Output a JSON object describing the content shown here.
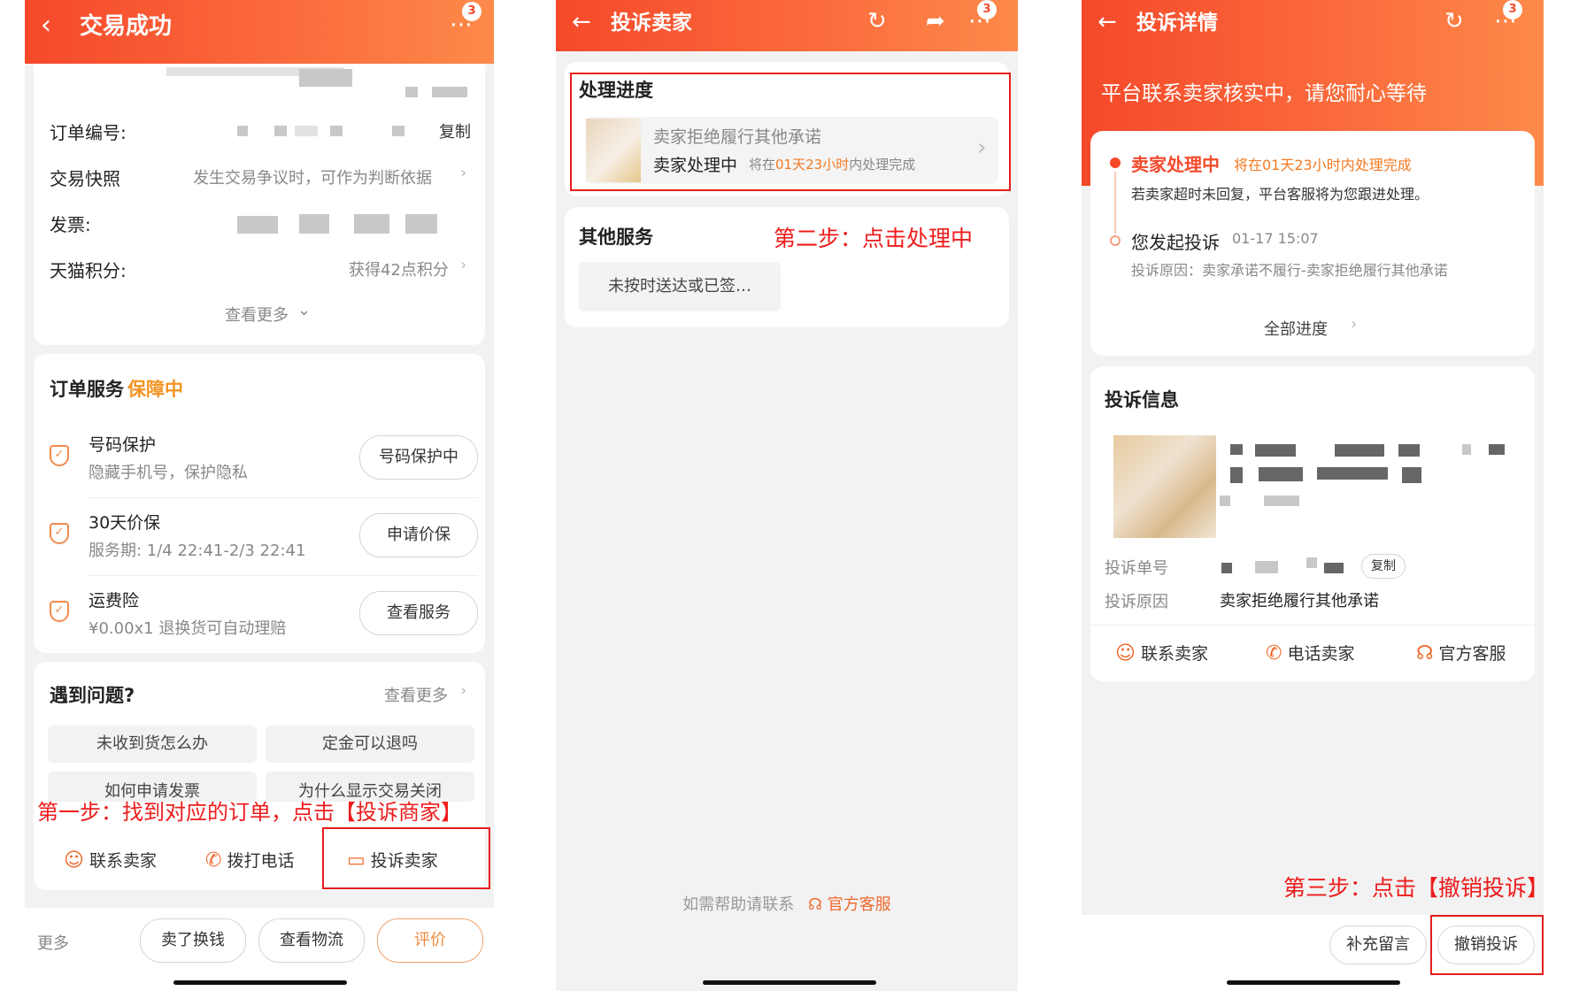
{
  "panel1": {
    "title": "交易成功",
    "badge": "3",
    "order_no_label": "订单编号:",
    "copy": "复制",
    "snapshot_label": "交易快照",
    "snapshot_value": "发生交易争议时，可作为判断依据",
    "invoice_label": "发票:",
    "points_label": "天猫积分:",
    "points_value": "获得42点积分",
    "see_more": "查看更多",
    "service_title": "订单服务",
    "service_status": "保障中",
    "services": [
      {
        "name": "号码保护",
        "desc": "隐藏手机号，保护隐私",
        "button": "号码保护中"
      },
      {
        "name": "30天价保",
        "desc": "服务期: 1/4 22:41-2/3 22:41",
        "button": "申请价保"
      },
      {
        "name": "运费险",
        "desc": "¥0.00x1 退换货可自动理赔",
        "button": "查看服务"
      }
    ],
    "problem_title": "遇到问题?",
    "problem_more": "查看更多",
    "faq": [
      "未收到货怎么办",
      "定金可以退吗",
      "如何申请发票",
      "为什么显示交易关闭"
    ],
    "step_note": "第一步：找到对应的订单，点击【投诉商家】",
    "actions": [
      "联系卖家",
      "拨打电话",
      "投诉卖家"
    ],
    "bottom_more": "更多",
    "bottom_buttons": [
      "卖了换钱",
      "查看物流",
      "评价"
    ]
  },
  "panel2": {
    "title": "投诉卖家",
    "badge": "3",
    "progress_title": "处理进度",
    "progress_reason": "卖家拒绝履行其他承诺",
    "progress_status": "卖家处理中",
    "progress_deadline_prefix": "将在",
    "progress_deadline_time": "01天23小时",
    "progress_deadline_suffix": "内处理完成",
    "other_title": "其他服务",
    "step_note": "第二步：点击处理中",
    "other_item": "未按时送达或已签…",
    "help_text": "如需帮助请联系",
    "help_link": "官方客服"
  },
  "panel3": {
    "title": "投诉详情",
    "badge": "3",
    "banner": "平台联系卖家核实中，请您耐心等待",
    "status": "卖家处理中",
    "status_deadline": "将在01天23小时内处理完成",
    "status_desc": "若卖家超时未回复，平台客服将为您跟进处理。",
    "event": "您发起投诉",
    "event_time": "01-17 15:07",
    "event_reason": "投诉原因：卖家承诺不履行-卖家拒绝履行其他承诺",
    "all_progress": "全部进度",
    "info_title": "投诉信息",
    "complaint_no_label": "投诉单号",
    "copy": "复制",
    "reason_label": "投诉原因",
    "reason_value": "卖家拒绝履行其他承诺",
    "actions": [
      "联系卖家",
      "电话卖家",
      "官方客服"
    ],
    "step_note": "第三步：点击【撤销投诉】",
    "bottom_buttons": [
      "补充留言",
      "撤销投诉"
    ]
  }
}
